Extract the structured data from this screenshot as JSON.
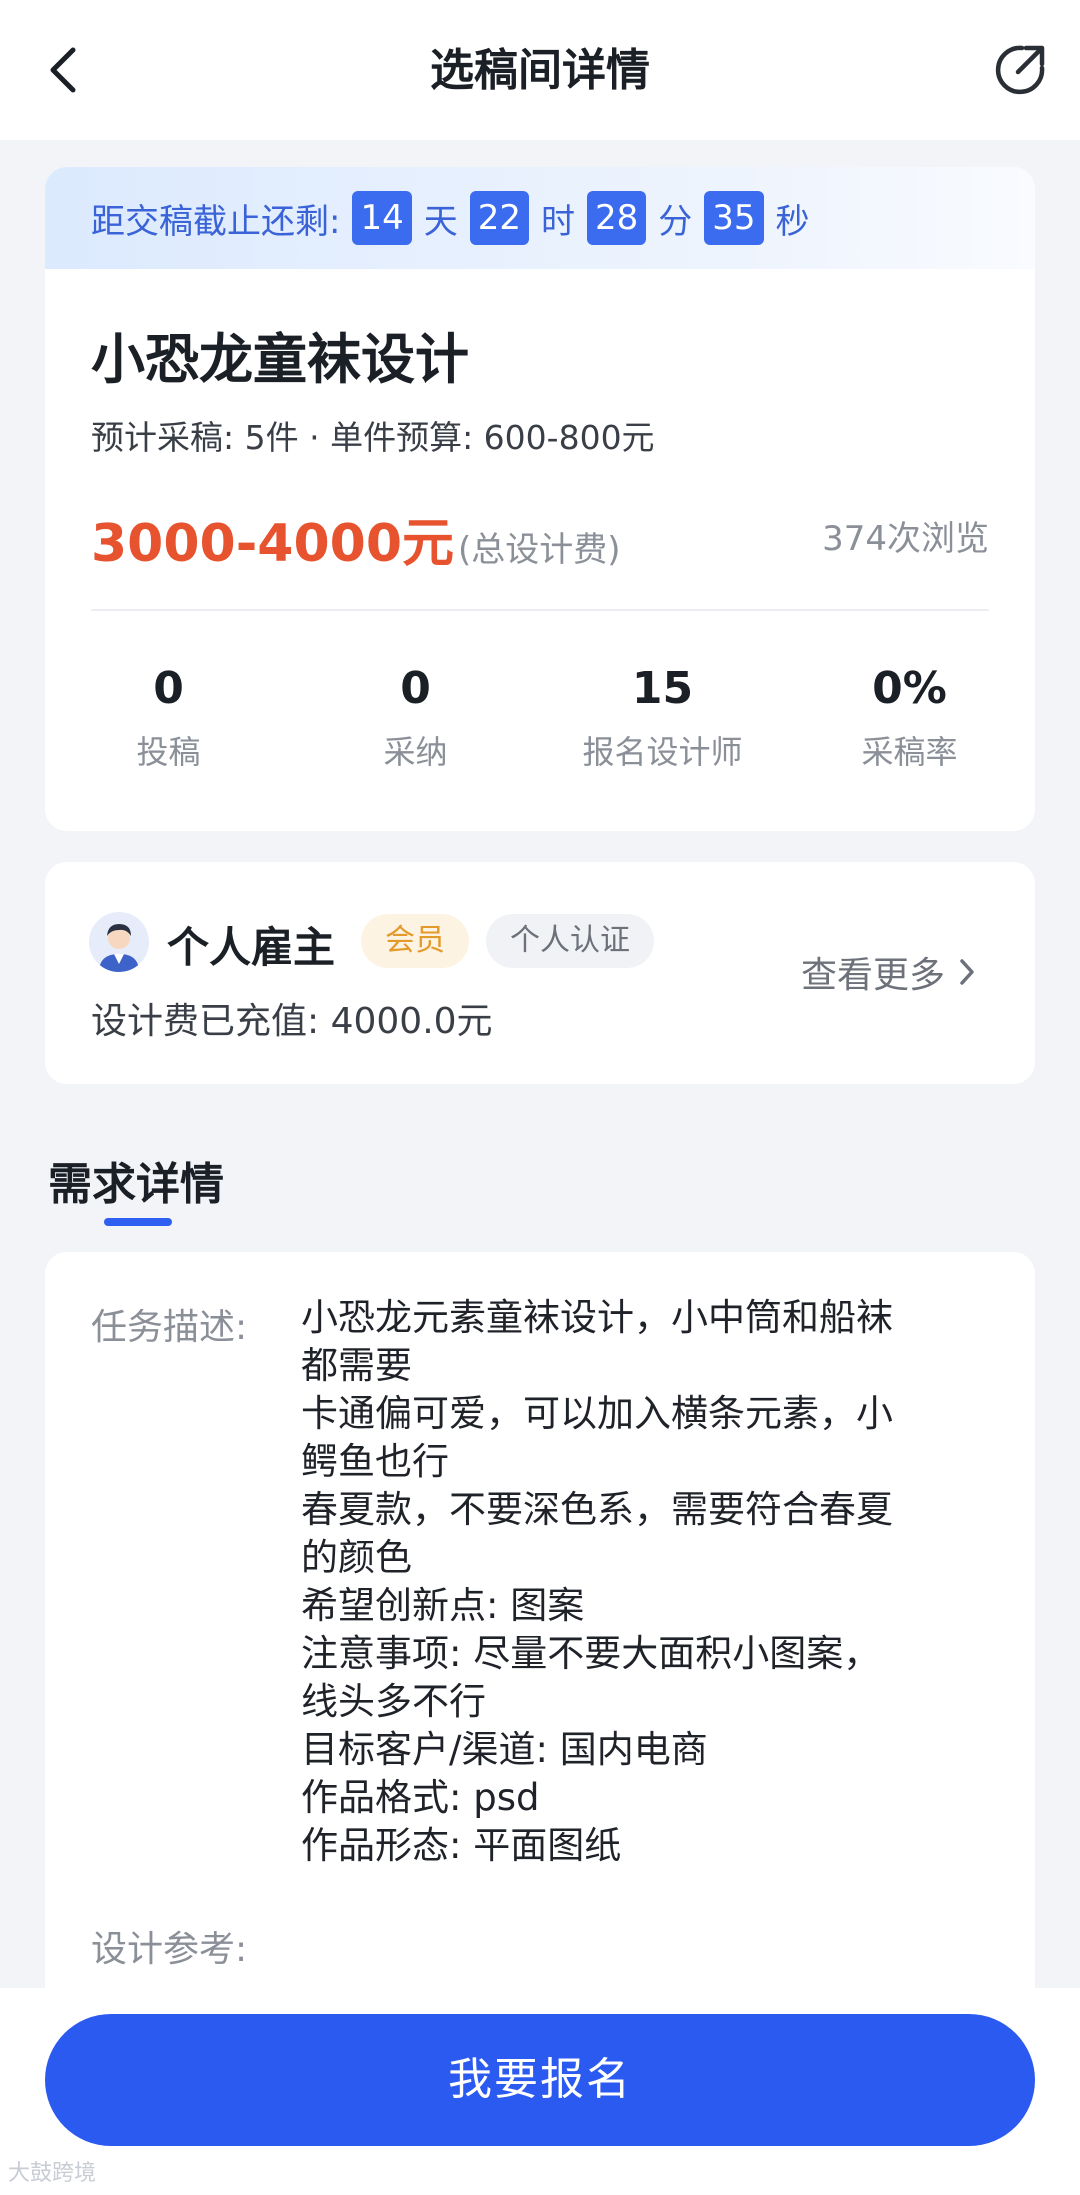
{
  "header": {
    "title": "选稿间详情",
    "back_icon": "back-chevron-icon",
    "share_icon": "share-icon"
  },
  "countdown": {
    "prefix": "距交稿截止还剩:",
    "days": "14",
    "days_unit": "天",
    "hours": "22",
    "hours_unit": "时",
    "minutes": "28",
    "minutes_unit": "分",
    "seconds": "35",
    "seconds_unit": "秒"
  },
  "task": {
    "title": "小恐龙童袜设计",
    "meta": "预计采稿: 5件 · 单件预算: 600-800元",
    "fee_amount": "3000-4000元",
    "fee_note": "(总设计费)",
    "views": "374次浏览"
  },
  "stats": [
    {
      "value": "0",
      "label": "投稿"
    },
    {
      "value": "0",
      "label": "采纳"
    },
    {
      "value": "15",
      "label": "报名设计师"
    },
    {
      "value": "0%",
      "label": "采稿率"
    }
  ],
  "employer": {
    "name": "个人雇主",
    "badge_member": "会员",
    "badge_verify": "个人认证",
    "charged": "设计费已充值: 4000.0元",
    "more": "查看更多"
  },
  "section": {
    "title": "需求详情"
  },
  "detail": {
    "desc_label": "任务描述:",
    "lines": [
      "小恐龙元素童袜设计，小中筒和船袜",
      "都需要",
      "卡通偏可爱，可以加入横条元素，小",
      "鳄鱼也行",
      "春夏款，不要深色系，需要符合春夏",
      "的颜色",
      "希望创新点: 图案",
      "注意事项: 尽量不要大面积小图案，",
      "线头多不行",
      "目标客户/渠道: 国内电商",
      "作品格式: psd",
      "作品形态: 平面图纸"
    ],
    "ref_label": "设计参考:"
  },
  "bottom": {
    "signup": "我要报名",
    "watermark": "大鼓跨境"
  },
  "colors": {
    "accent": "#2b5af0",
    "price": "#e7532f",
    "member": "#e49a2a"
  }
}
